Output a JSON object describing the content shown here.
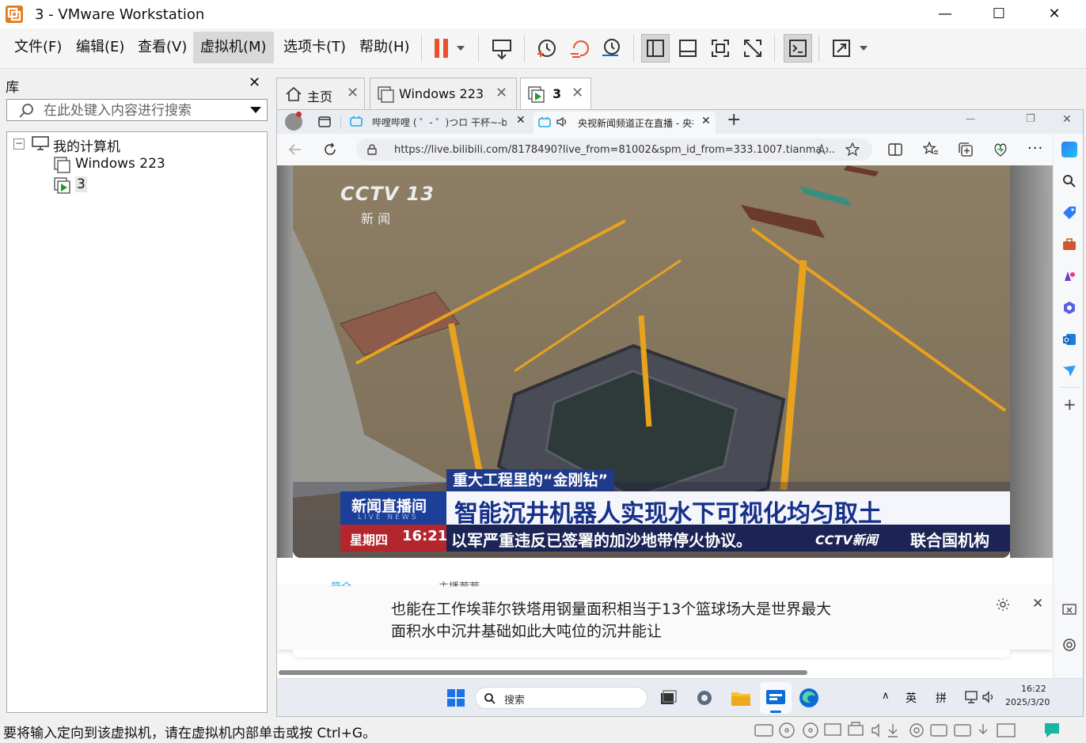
{
  "window": {
    "title": "3 - VMware Workstation",
    "minimize": "—",
    "maximize": "☐",
    "close": "✕"
  },
  "menu": [
    "文件(F)",
    "编辑(E)",
    "查看(V)",
    "虚拟机(M)",
    "选项卡(T)",
    "帮助(H)"
  ],
  "library": {
    "title": "库",
    "close": "✕",
    "search_placeholder": "在此处键入内容进行搜索",
    "tree": {
      "root": "我的计算机",
      "collapse": "−",
      "children": [
        "Windows 223",
        "3"
      ]
    }
  },
  "vm_tabs": [
    {
      "label": "主页"
    },
    {
      "label": "Windows 223"
    },
    {
      "label": "3"
    }
  ],
  "tab_close": "✕",
  "browser": {
    "tabs": [
      {
        "label": "哔哩哔哩 ( ゜- ゜)つロ 干杯~-bilib"
      },
      {
        "label": "央视新闻频道正在直播 - 央视"
      }
    ],
    "new_tab": "+",
    "url": "https://live.bilibili.com/8178490?live_from=81002&spm_id_from=333.1007.tianma....",
    "win_min": "—",
    "win_max": "❐",
    "win_close": "✕"
  },
  "video": {
    "logo": "CCTV 13",
    "logo_sub": "新  闻",
    "topic": "重大工程里的“金刚钻”",
    "program": "新闻直播间",
    "program_sub": "LIVE NEWS",
    "weekday": "星期四",
    "time": "16:21",
    "headline": "智能沉井机器人实现水下可视化均匀取土",
    "ticker": "以军严重违反已签署的加沙地带停火协议。",
    "ticker_logo": "CCTV新闻",
    "ticker_tail": "联合国机构"
  },
  "page_tabs": [
    "简介",
    "主播荐荐"
  ],
  "caption": {
    "line1": "也能在工作埃菲尔铁塔用钢量面积相当于13个篮球场大是世界最大",
    "line2": "面积水中沉井基础如此大吨位的沉井能让",
    "close": "✕"
  },
  "taskbar": {
    "search": "搜索",
    "ime1": "英",
    "ime2": "拼",
    "time": "16:22",
    "date": "2025/3/20",
    "chevron": "∧"
  },
  "status": {
    "text": "要将输入定向到该虚拟机，请在虚拟机内部单击或按 Ctrl+G。"
  },
  "colors": {
    "accent_orange": "#f28b24",
    "pause": "#e8512a",
    "edge_blue": "#0a6cd8"
  }
}
